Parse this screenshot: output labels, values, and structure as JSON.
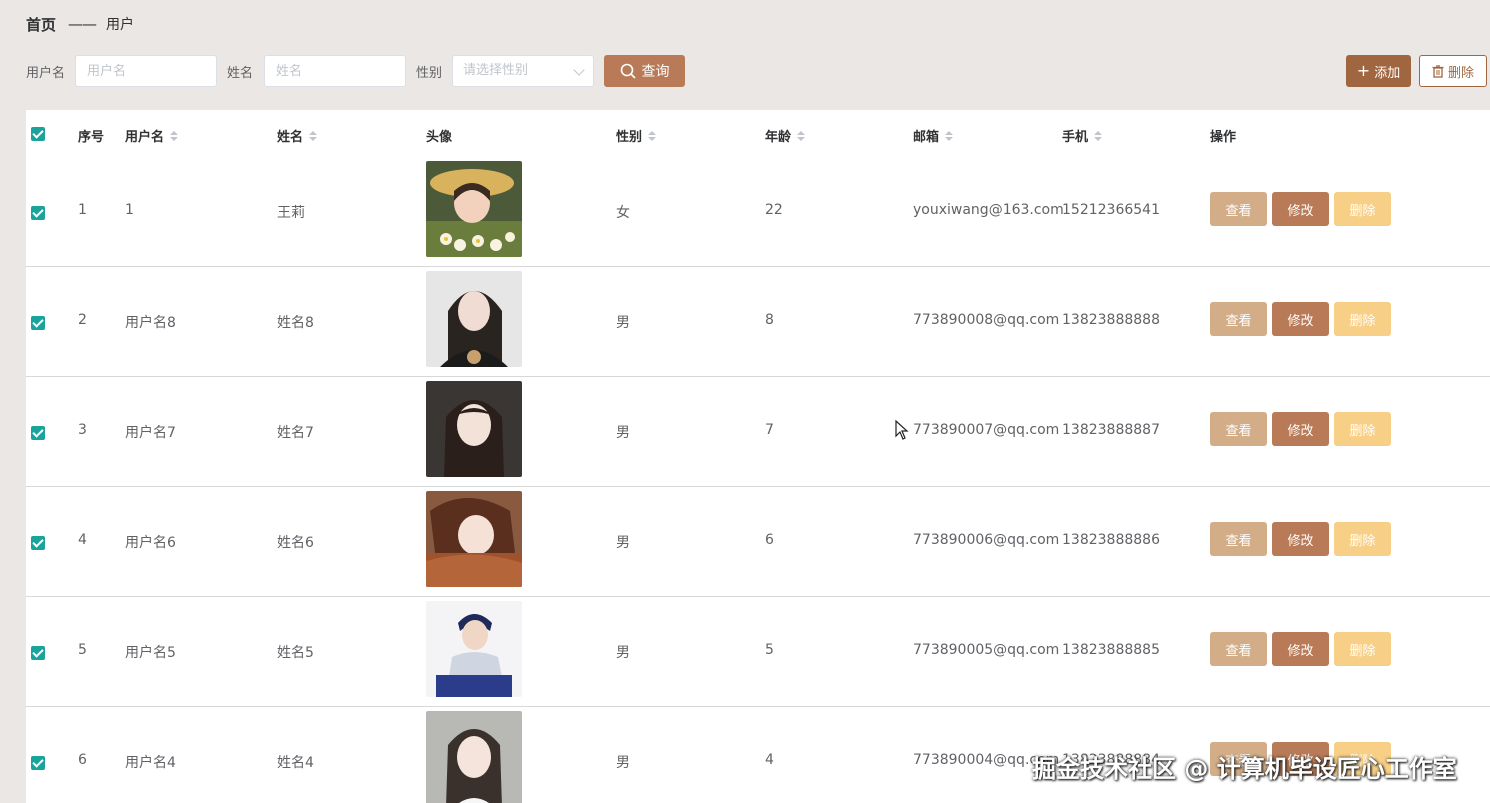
{
  "breadcrumb": {
    "home": "首页",
    "separator": "——",
    "current": "用户"
  },
  "filters": {
    "username_label": "用户名",
    "username_placeholder": "用户名",
    "name_label": "姓名",
    "name_placeholder": "姓名",
    "gender_label": "性别",
    "gender_placeholder": "请选择性别",
    "search_button": "查询"
  },
  "actions": {
    "add_button": "添加",
    "delete_button": "删除"
  },
  "table": {
    "columns": [
      "序号",
      "用户名",
      "姓名",
      "头像",
      "性别",
      "年龄",
      "邮箱",
      "手机",
      "操作"
    ],
    "row_actions": {
      "view": "查看",
      "edit": "修改",
      "delete": "删除"
    },
    "rows": [
      {
        "index": "1",
        "username": "1",
        "name": "王莉",
        "gender": "女",
        "age": "22",
        "email": "youxiwang@163.com",
        "phone": "15212366541",
        "checked": true
      },
      {
        "index": "2",
        "username": "用户名8",
        "name": "姓名8",
        "gender": "男",
        "age": "8",
        "email": "773890008@qq.com",
        "phone": "13823888888",
        "checked": true
      },
      {
        "index": "3",
        "username": "用户名7",
        "name": "姓名7",
        "gender": "男",
        "age": "7",
        "email": "773890007@qq.com",
        "phone": "13823888887",
        "checked": true
      },
      {
        "index": "4",
        "username": "用户名6",
        "name": "姓名6",
        "gender": "男",
        "age": "6",
        "email": "773890006@qq.com",
        "phone": "13823888886",
        "checked": true
      },
      {
        "index": "5",
        "username": "用户名5",
        "name": "姓名5",
        "gender": "男",
        "age": "5",
        "email": "773890005@qq.com",
        "phone": "13823888885",
        "checked": true
      },
      {
        "index": "6",
        "username": "用户名4",
        "name": "姓名4",
        "gender": "男",
        "age": "4",
        "email": "773890004@qq.com",
        "phone": "13823888884",
        "checked": true
      }
    ]
  },
  "watermark": "掘金技术社区 @ 计算机毕设匠心工作室",
  "colors": {
    "accent": "#b87a57",
    "add": "#a0663f",
    "view": "#d2ad88",
    "remove": "#f8cf86",
    "checkbox": "#1aa39a"
  }
}
